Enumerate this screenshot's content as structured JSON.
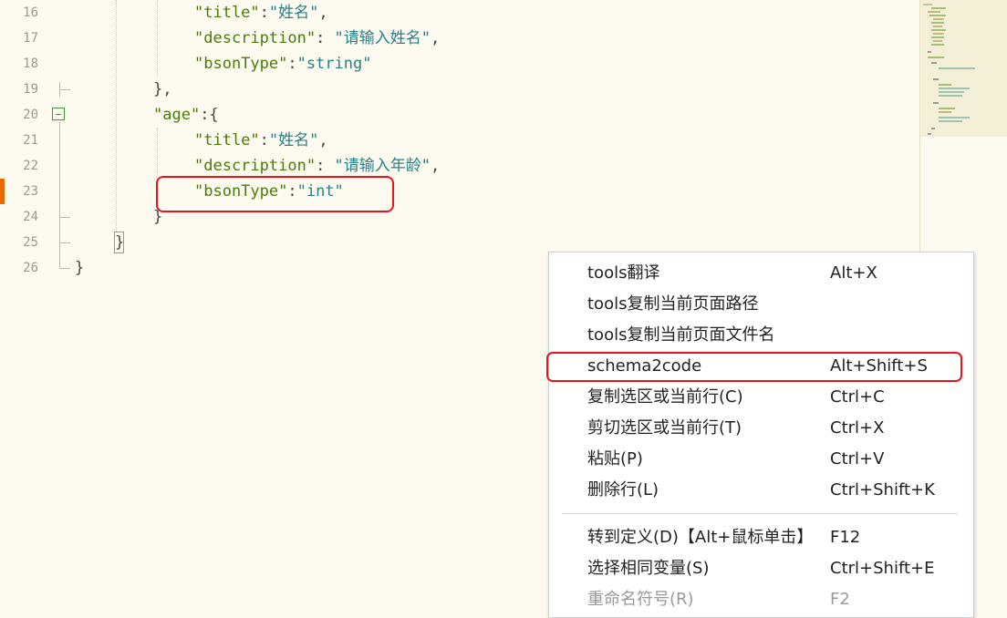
{
  "editor": {
    "lines": [
      {
        "number": "16",
        "tokens": [
          {
            "t": "\"title\"",
            "c": "tok-key"
          },
          {
            "t": ":",
            "c": "tok-punc"
          },
          {
            "t": "\"姓名\"",
            "c": "tok-str"
          },
          {
            "t": ",",
            "c": "tok-punc"
          }
        ]
      },
      {
        "number": "17",
        "tokens": [
          {
            "t": "\"description\"",
            "c": "tok-key"
          },
          {
            "t": ": ",
            "c": "tok-punc"
          },
          {
            "t": "\"请输入姓名\"",
            "c": "tok-str"
          },
          {
            "t": ",",
            "c": "tok-punc"
          }
        ]
      },
      {
        "number": "18",
        "tokens": [
          {
            "t": "\"bsonType\"",
            "c": "tok-key"
          },
          {
            "t": ":",
            "c": "tok-punc"
          },
          {
            "t": "\"string\"",
            "c": "tok-str"
          }
        ]
      },
      {
        "number": "19",
        "tokens": [
          {
            "t": "},",
            "c": "tok-brace"
          }
        ]
      },
      {
        "number": "20",
        "tokens": [
          {
            "t": "\"age\"",
            "c": "tok-key"
          },
          {
            "t": ":{",
            "c": "tok-punc"
          }
        ]
      },
      {
        "number": "21",
        "tokens": [
          {
            "t": "\"title\"",
            "c": "tok-key"
          },
          {
            "t": ":",
            "c": "tok-punc"
          },
          {
            "t": "\"姓名\"",
            "c": "tok-str"
          },
          {
            "t": ",",
            "c": "tok-punc"
          }
        ]
      },
      {
        "number": "22",
        "tokens": [
          {
            "t": "\"description\"",
            "c": "tok-key"
          },
          {
            "t": ": ",
            "c": "tok-punc"
          },
          {
            "t": "\"请输入年龄\"",
            "c": "tok-str"
          },
          {
            "t": ",",
            "c": "tok-punc"
          }
        ]
      },
      {
        "number": "23",
        "tokens": [
          {
            "t": "\"bsonType\"",
            "c": "tok-key"
          },
          {
            "t": ":",
            "c": "tok-punc"
          },
          {
            "t": "\"int\"",
            "c": "tok-str"
          }
        ]
      },
      {
        "number": "24",
        "tokens": [
          {
            "t": "}",
            "c": "tok-brace"
          }
        ]
      },
      {
        "number": "25",
        "tokens": [
          {
            "t": "}",
            "c": "tok-brace"
          }
        ]
      },
      {
        "number": "26",
        "tokens": [
          {
            "t": "}",
            "c": "tok-brace"
          }
        ]
      }
    ]
  },
  "context_menu": {
    "items": [
      {
        "label": "tools翻译",
        "shortcut": "Alt+X"
      },
      {
        "label": "tools复制当前页面路径",
        "shortcut": ""
      },
      {
        "label": "tools复制当前页面文件名",
        "shortcut": ""
      },
      {
        "label": "schema2code",
        "shortcut": "Alt+Shift+S"
      },
      {
        "label": "复制选区或当前行(C)",
        "shortcut": "Ctrl+C"
      },
      {
        "label": "剪切选区或当前行(T)",
        "shortcut": "Ctrl+X"
      },
      {
        "label": "粘贴(P)",
        "shortcut": "Ctrl+V"
      },
      {
        "label": "删除行(L)",
        "shortcut": "Ctrl+Shift+K"
      },
      {
        "label": "转到定义(D)【Alt+鼠标单击】",
        "shortcut": "F12"
      },
      {
        "label": "选择相同变量(S)",
        "shortcut": "Ctrl+Shift+E"
      },
      {
        "label": "重命名符号(R)",
        "shortcut": "F2",
        "disabled": true
      }
    ]
  },
  "colors": {
    "editor_bg": "#fdfbf0",
    "key": "#4a7a0a",
    "string": "#2a7f86",
    "highlight_border": "#e8141b",
    "modified_marker": "#e86a00"
  }
}
